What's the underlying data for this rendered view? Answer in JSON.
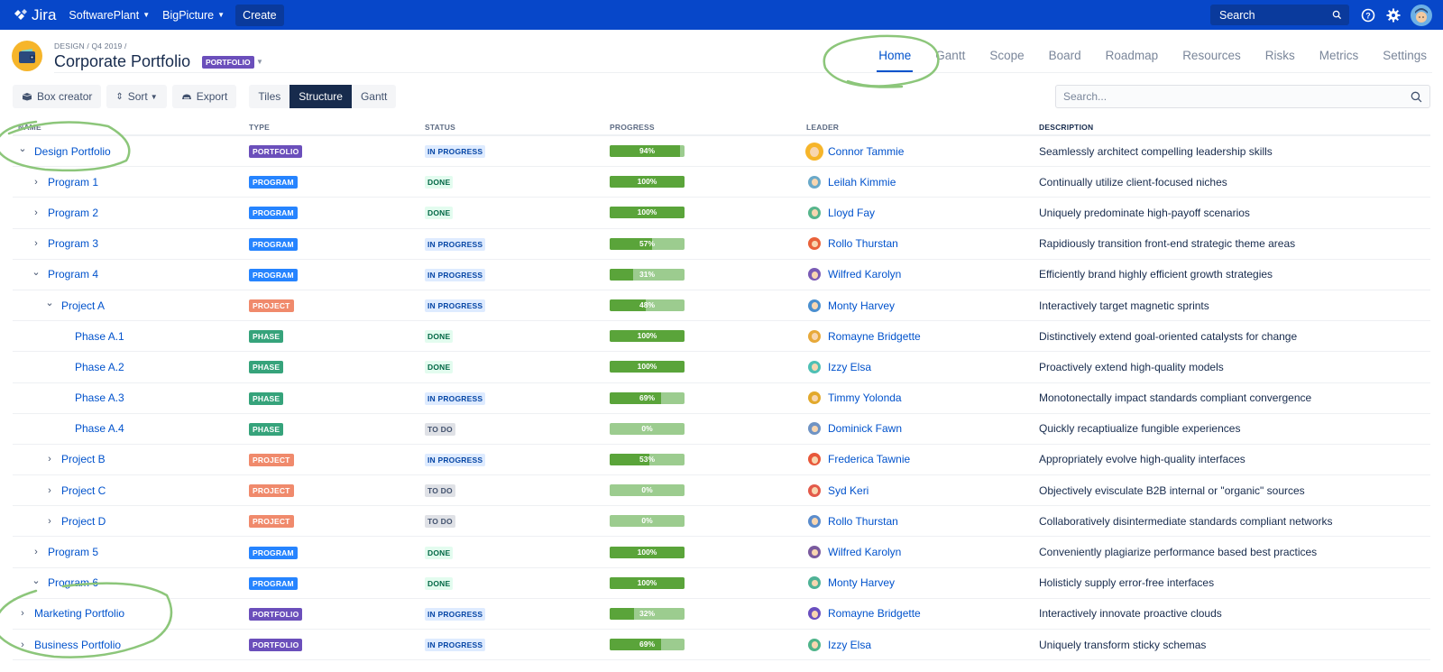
{
  "topnav": {
    "logo_text": "Jira",
    "items": [
      {
        "label": "SoftwarePlant",
        "has_caret": true
      },
      {
        "label": "BigPicture",
        "has_caret": true
      }
    ],
    "create_label": "Create",
    "search_placeholder": "Search",
    "icons": [
      "search-icon",
      "help-icon",
      "settings-icon",
      "user-avatar"
    ]
  },
  "header": {
    "breadcrumb": "DESIGN / Q4 2019 /",
    "title": "Corporate Portfolio",
    "badge": "PORTFOLIO",
    "tabs": [
      {
        "label": "Home",
        "active": true
      },
      {
        "label": "Gantt",
        "active": false
      },
      {
        "label": "Scope",
        "active": false
      },
      {
        "label": "Board",
        "active": false
      },
      {
        "label": "Roadmap",
        "active": false
      },
      {
        "label": "Resources",
        "active": false
      },
      {
        "label": "Risks",
        "active": false
      },
      {
        "label": "Metrics",
        "active": false
      },
      {
        "label": "Settings",
        "active": false
      }
    ]
  },
  "toolbar": {
    "box_creator": "Box creator",
    "sort": "Sort",
    "export": "Export",
    "views": [
      {
        "label": "Tiles",
        "active": false
      },
      {
        "label": "Structure",
        "active": true
      },
      {
        "label": "Gantt",
        "active": false
      }
    ],
    "search_placeholder": "Search..."
  },
  "colors": {
    "nav_bg": "#0747c9",
    "link": "#0052cc",
    "portfolio": "#6b4fbb",
    "program": "#2684ff",
    "project": "#f08a6c",
    "phase": "#36a37b",
    "progress_fill": "#5aa43a",
    "progress_track": "#9ccc8f",
    "annotation": "#8cc67a"
  },
  "table": {
    "columns": [
      "NAME",
      "TYPE",
      "STATUS",
      "PROGRESS",
      "LEADER",
      "DESCRIPTION"
    ],
    "rows": [
      {
        "name": "Design Portfolio",
        "level": 0,
        "expander": "expanded",
        "type": "PORTFOLIO",
        "status": "IN PROGRESS",
        "progress": 94,
        "leader": "Connor Tammie",
        "avatar_color": "#f6b52a",
        "description": "Seamlessly architect compelling leadership skills"
      },
      {
        "name": "Program 1",
        "level": 1,
        "expander": "collapsed",
        "type": "PROGRAM",
        "status": "DONE",
        "progress": 100,
        "leader": "Leilah Kimmie",
        "avatar_color": "#6aa9c9",
        "description": "Continually utilize client-focused niches"
      },
      {
        "name": "Program 2",
        "level": 1,
        "expander": "collapsed",
        "type": "PROGRAM",
        "status": "DONE",
        "progress": 100,
        "leader": "Lloyd Fay",
        "avatar_color": "#57b58c",
        "description": "Uniquely predominate high-payoff scenarios"
      },
      {
        "name": "Program 3",
        "level": 1,
        "expander": "collapsed",
        "type": "PROGRAM",
        "status": "IN PROGRESS",
        "progress": 57,
        "leader": "Rollo Thurstan",
        "avatar_color": "#e9623a",
        "description": "Rapidiously transition front-end strategic theme areas"
      },
      {
        "name": "Program 4",
        "level": 1,
        "expander": "expanded",
        "type": "PROGRAM",
        "status": "IN PROGRESS",
        "progress": 31,
        "leader": "Wilfred Karolyn",
        "avatar_color": "#7a5bb5",
        "description": "Efficiently brand highly efficient growth strategies"
      },
      {
        "name": "Project A",
        "level": 2,
        "expander": "expanded",
        "type": "PROJECT",
        "status": "IN PROGRESS",
        "progress": 48,
        "leader": "Monty Harvey",
        "avatar_color": "#4a8fcf",
        "description": "Interactively target magnetic sprints"
      },
      {
        "name": "Phase A.1",
        "level": 3,
        "expander": "none",
        "type": "PHASE",
        "status": "DONE",
        "progress": 100,
        "leader": "Romayne Bridgette",
        "avatar_color": "#e7a93a",
        "description": "Distinctively extend goal-oriented catalysts for change"
      },
      {
        "name": "Phase A.2",
        "level": 3,
        "expander": "none",
        "type": "PHASE",
        "status": "DONE",
        "progress": 100,
        "leader": "Izzy Elsa",
        "avatar_color": "#4fc0b4",
        "description": "Proactively extend high-quality models"
      },
      {
        "name": "Phase A.3",
        "level": 3,
        "expander": "none",
        "type": "PHASE",
        "status": "IN PROGRESS",
        "progress": 69,
        "leader": "Timmy Yolonda",
        "avatar_color": "#e2a92c",
        "description": "Monotonectally impact standards compliant convergence"
      },
      {
        "name": "Phase A.4",
        "level": 3,
        "expander": "none",
        "type": "PHASE",
        "status": "TO DO",
        "progress": 0,
        "leader": "Dominick Fawn",
        "avatar_color": "#6f93c4",
        "description": "Quickly recaptiualize fungible experiences"
      },
      {
        "name": "Project B",
        "level": 2,
        "expander": "collapsed",
        "type": "PROJECT",
        "status": "IN PROGRESS",
        "progress": 53,
        "leader": "Frederica Tawnie",
        "avatar_color": "#e8583a",
        "description": "Appropriately evolve high-quality interfaces"
      },
      {
        "name": "Project C",
        "level": 2,
        "expander": "collapsed",
        "type": "PROJECT",
        "status": "TO DO",
        "progress": 0,
        "leader": "Syd Keri",
        "avatar_color": "#e35a4a",
        "description": "Objectively evisculate B2B internal or \"organic\" sources"
      },
      {
        "name": "Project D",
        "level": 2,
        "expander": "collapsed",
        "type": "PROJECT",
        "status": "TO DO",
        "progress": 0,
        "leader": "Rollo Thurstan",
        "avatar_color": "#5b8ccc",
        "description": "Collaboratively disintermediate standards compliant networks"
      },
      {
        "name": "Program 5",
        "level": 1,
        "expander": "collapsed",
        "type": "PROGRAM",
        "status": "DONE",
        "progress": 100,
        "leader": "Wilfred Karolyn",
        "avatar_color": "#7a5a9e",
        "description": "Conveniently plagiarize performance based best practices"
      },
      {
        "name": "Program 6",
        "level": 1,
        "expander": "expanded",
        "type": "PROGRAM",
        "status": "DONE",
        "progress": 100,
        "leader": "Monty Harvey",
        "avatar_color": "#4fb296",
        "description": "Holisticly supply error-free interfaces"
      },
      {
        "name": "Marketing Portfolio",
        "level": 0,
        "expander": "collapsed",
        "type": "PORTFOLIO",
        "status": "IN PROGRESS",
        "progress": 32,
        "leader": "Romayne Bridgette",
        "avatar_color": "#6a4fbf",
        "description": "Interactively innovate proactive clouds"
      },
      {
        "name": "Business Portfolio",
        "level": 0,
        "expander": "collapsed",
        "type": "PORTFOLIO",
        "status": "IN PROGRESS",
        "progress": 69,
        "leader": "Izzy Elsa",
        "avatar_color": "#4fb48a",
        "description": "Uniquely transform sticky schemas"
      }
    ]
  }
}
